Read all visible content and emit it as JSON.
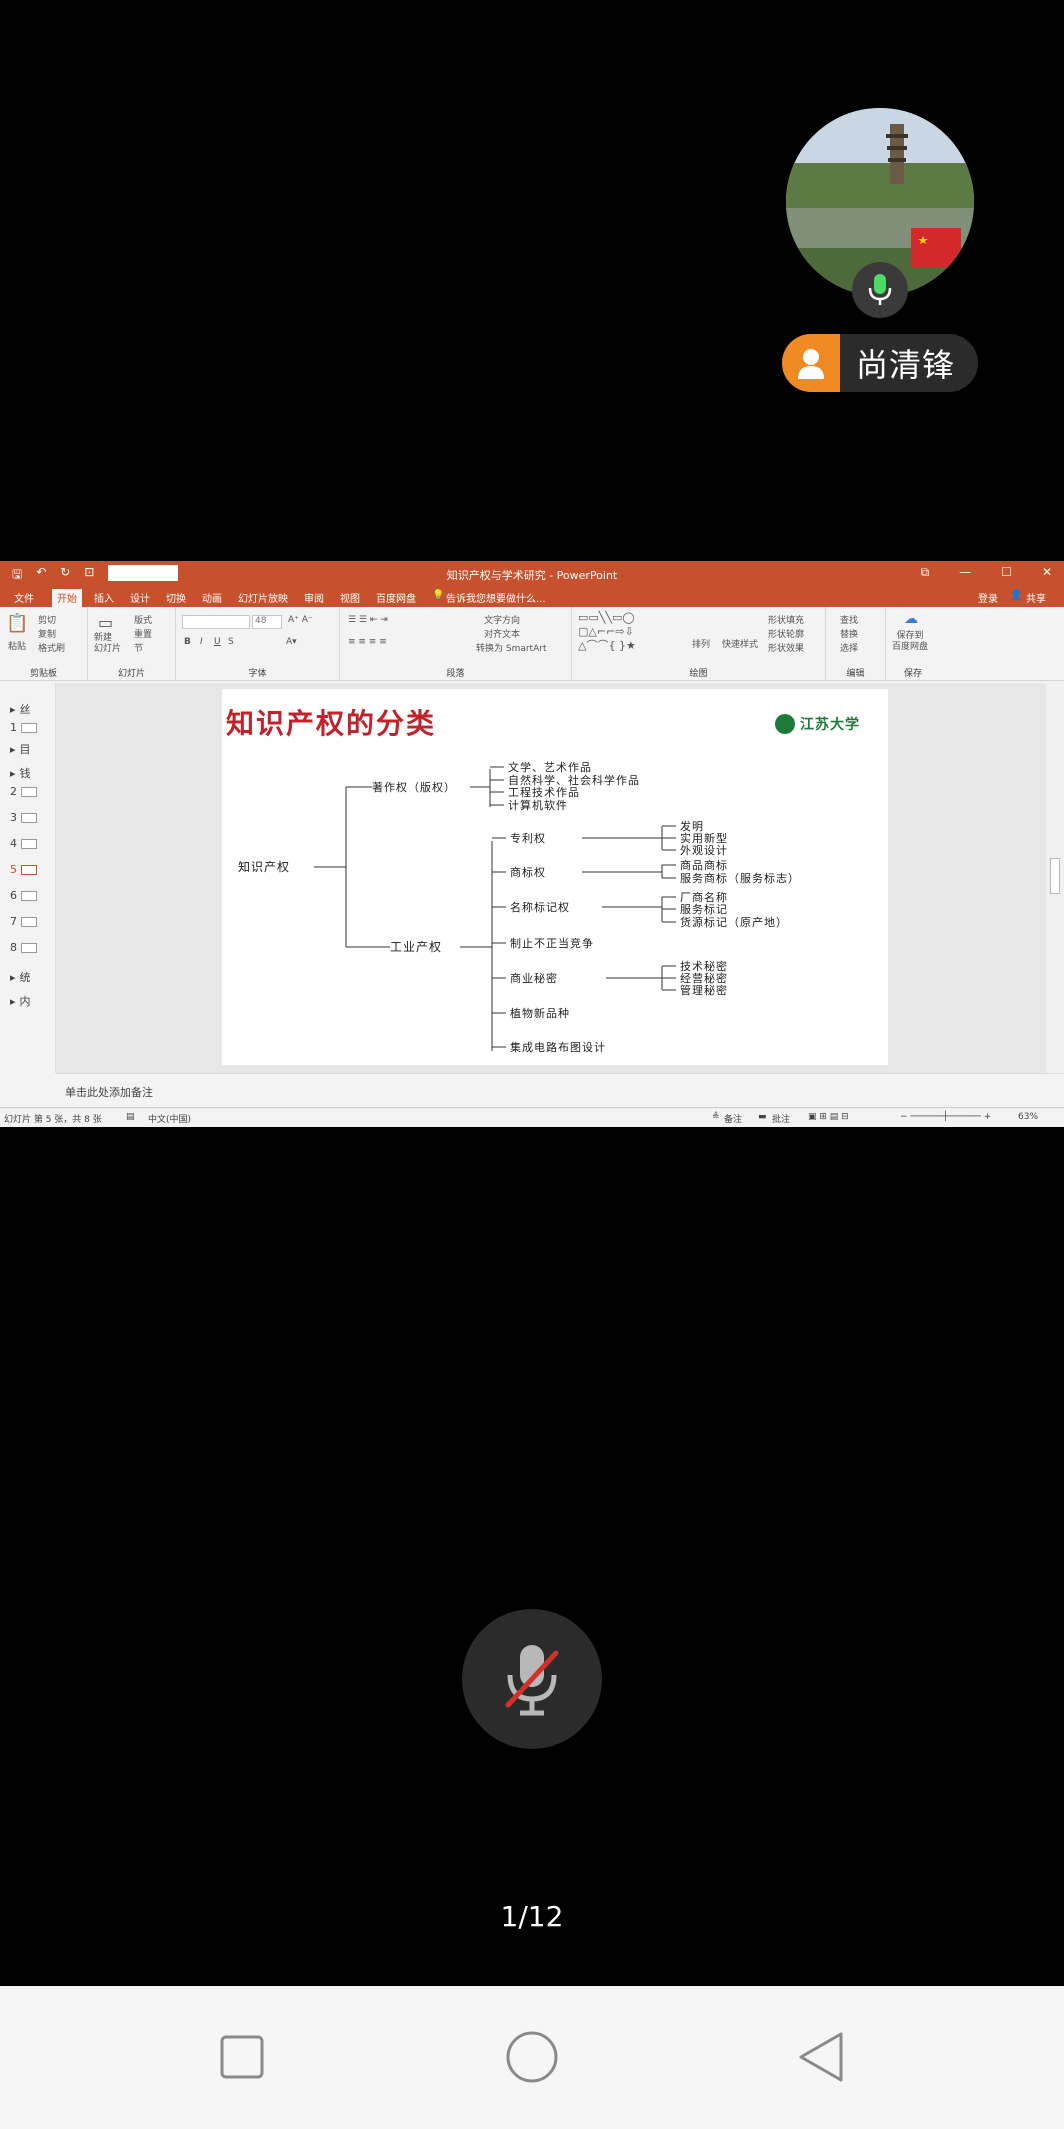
{
  "participant": {
    "name": "尚清锋"
  },
  "ppt": {
    "window_title": "知识产权与学术研究 - PowerPoint",
    "tabs": [
      "文件",
      "开始",
      "插入",
      "设计",
      "切换",
      "动画",
      "幻灯片放映",
      "审阅",
      "视图",
      "百度网盘"
    ],
    "active_tab": "开始",
    "tell_me": "告诉我您想要做什么...",
    "login": "登录",
    "share": "共享",
    "ribbon": {
      "paste": "粘贴",
      "cut": "剪切",
      "copy": "复制",
      "format_painter": "格式刷",
      "clipboard_label": "剪贴板",
      "new_slide": "新建\n幻灯片",
      "layout": "版式",
      "reset": "重置",
      "section": "节",
      "slides_label": "幻灯片",
      "font_size": "48",
      "font_label": "字体",
      "text_direction": "文字方向",
      "align_text": "对齐文本",
      "convert_smartart": "转换为 SmartArt",
      "paragraph_label": "段落",
      "arrange": "排列",
      "quick_styles": "快速样式",
      "shape_fill": "形状填充",
      "shape_outline": "形状轮廓",
      "shape_effects": "形状效果",
      "drawing_label": "绘图",
      "find": "查找",
      "replace": "替换",
      "select": "选择",
      "editing_label": "编辑",
      "save_to_baidu": "保存到\n百度网盘",
      "save_label": "保存"
    },
    "thumbnails": [
      {
        "num": "",
        "label": "丝"
      },
      {
        "num": "1",
        "label": ""
      },
      {
        "num": "",
        "label": "目"
      },
      {
        "num": "",
        "label": "钱"
      },
      {
        "num": "2",
        "label": ""
      },
      {
        "num": "3",
        "label": ""
      },
      {
        "num": "4",
        "label": ""
      },
      {
        "num": "5",
        "label": ""
      },
      {
        "num": "6",
        "label": ""
      },
      {
        "num": "7",
        "label": ""
      },
      {
        "num": "8",
        "label": ""
      },
      {
        "num": "",
        "label": "统"
      },
      {
        "num": "",
        "label": "内"
      }
    ],
    "current_slide_index": 7,
    "notes_placeholder": "单击此处添加备注",
    "status": {
      "slide_of": "幻灯片 第 5 张，共 8 张",
      "language": "中文(中国)",
      "notes": "备注",
      "comments": "批注",
      "zoom": "63%"
    }
  },
  "slide": {
    "title": "知识产权的分类",
    "logo": "江苏大学",
    "root": "知识产权",
    "copyright": "著作权（版权）",
    "copyright_items": [
      "文学、艺术作品",
      "自然科学、社会科学作品",
      "工程技术作品",
      "计算机软件"
    ],
    "industrial": "工业产权",
    "industrial_items": [
      "专利权",
      "商标权",
      "名称标记权",
      "制止不正当竞争",
      "商业秘密",
      "植物新品种",
      "集成电路布图设计"
    ],
    "patent_items": [
      "发明",
      "实用新型",
      "外观设计"
    ],
    "trademark_items": [
      "商品商标",
      "服务商标（服务标志）"
    ],
    "name_items": [
      "厂商名称",
      "服务标记",
      "货源标记（原产地）"
    ],
    "secret_items": [
      "技术秘密",
      "经营秘密",
      "管理秘密"
    ]
  },
  "meeting": {
    "page_counter": "1/12"
  },
  "colors": {
    "ppt_accent": "#c7502d",
    "slide_title": "#c0232b",
    "pill_orange": "#f08a22",
    "mute_slash": "#d0322a"
  }
}
